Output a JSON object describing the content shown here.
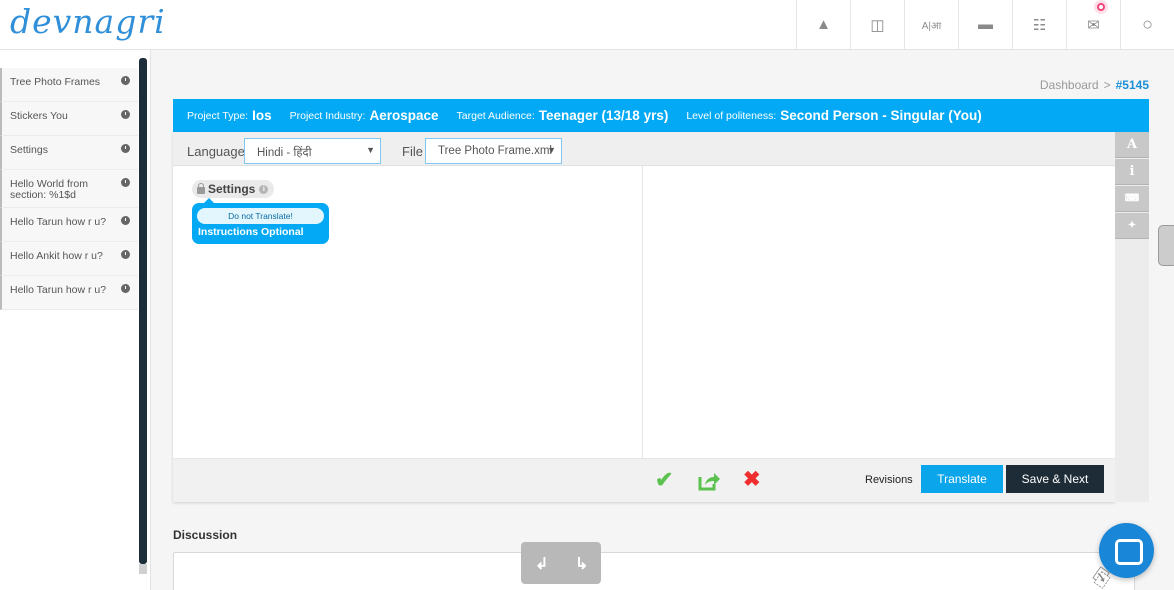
{
  "brand": {
    "logo_text": "devnagri"
  },
  "topnav": {
    "icons": [
      "user-icon",
      "columns-icon",
      "translate-icon",
      "card-icon",
      "list-icon",
      "mail-icon",
      "account-icon"
    ],
    "glyphs": [
      "▲",
      "◫",
      "A|आ",
      "▬",
      "☷",
      "✉",
      "○"
    ]
  },
  "sidebar": {
    "items": [
      {
        "label": "Tree Photo Frames"
      },
      {
        "label": "Stickers You"
      },
      {
        "label": "Settings"
      },
      {
        "label": "Hello World from section: %1$d"
      },
      {
        "label": "Hello Tarun how r u?"
      },
      {
        "label": "Hello Ankit how r u?"
      },
      {
        "label": "Hello Tarun how r u?"
      }
    ]
  },
  "breadcrumb": {
    "dashboard": "Dashboard",
    "separator": ">",
    "project": "#5145"
  },
  "project": {
    "type_label": "Project Type:",
    "type_value": "Ios",
    "industry_label": "Project Industry:",
    "industry_value": "Aerospace",
    "audience_label": "Target Audience:",
    "audience_value": "Teenager (13/18 yrs)",
    "politeness_label": "Level of politeness:",
    "politeness_value": "Second Person - Singular (You)"
  },
  "editor": {
    "language_label": "Language",
    "language_value": "Hindi - हिंदी",
    "file_label": "File",
    "file_value": "Tree Photo Frame.xml",
    "source_tag": "Settings",
    "do_not_translate": "Do not Translate!",
    "instructions": "Instructions Optional"
  },
  "actions": {
    "revisions": "Revisions",
    "translate": "Translate",
    "save_next": "Save & Next",
    "approve_glyph": "✔",
    "reject_glyph": "✖"
  },
  "tools": {
    "font_glyph": "A",
    "info_glyph": "i",
    "keyboard_glyph": "⌨",
    "compress_glyph": "✦"
  },
  "discussion": {
    "title": "Discussion",
    "undo_glyph": "↲",
    "redo_glyph": "↳",
    "attach_glyph": "⎘"
  },
  "colors": {
    "primary": "#03a9f4",
    "dark": "#1e2c37",
    "approve": "#5cc24f",
    "reject": "#ef2f2f",
    "logo": "#2f8fd8"
  }
}
